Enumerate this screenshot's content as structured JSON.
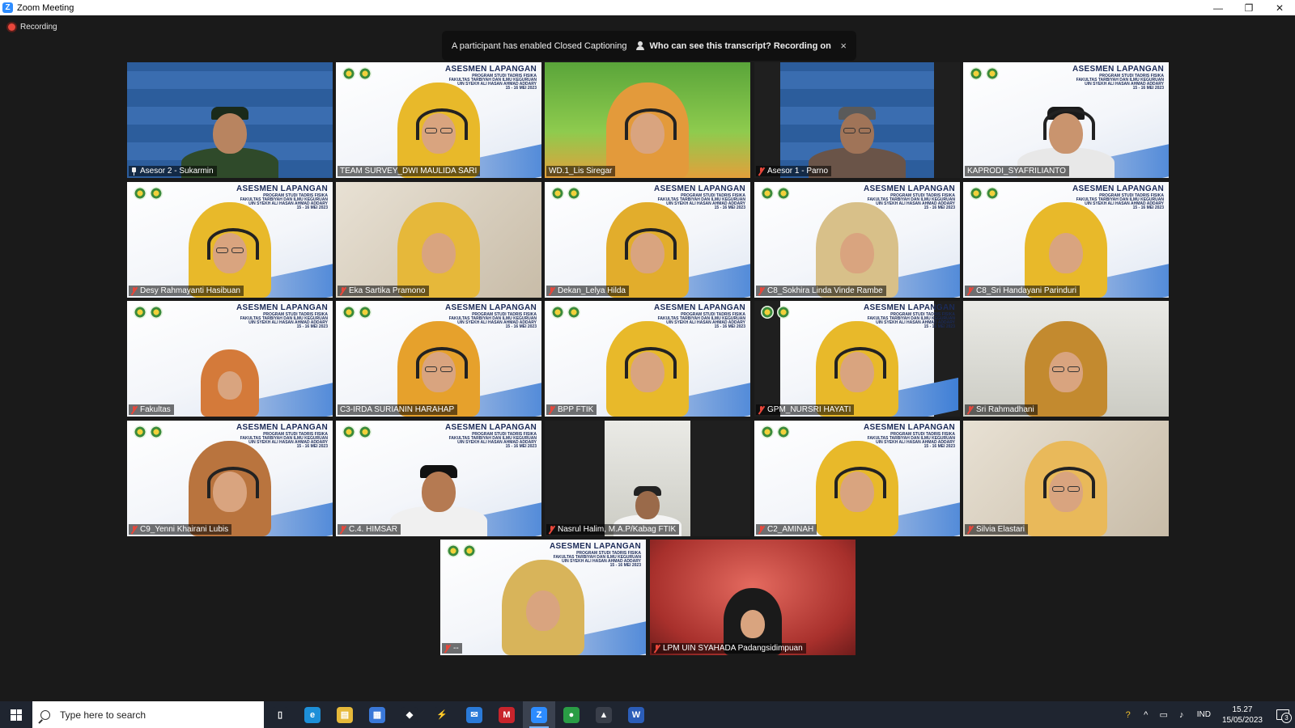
{
  "window": {
    "title": "Zoom Meeting",
    "controls": [
      "minimize",
      "restore",
      "close"
    ]
  },
  "recording": {
    "label": "Recording"
  },
  "caption_banner": {
    "message": "A participant has enabled Closed Captioning",
    "link": "Who can see this transcript? Recording on",
    "close_label": "×"
  },
  "participants": [
    {
      "name": "Asesor 2 - Sukarmin",
      "bg": "blue",
      "icon": "pin",
      "hijab": false,
      "skin": "#b88460",
      "outfit": "#2f4a2a",
      "cap": "#1a2a1a"
    },
    {
      "name": "TEAM SURVEY_DWI MAULIDA SARI",
      "bg": "white",
      "icon": "none",
      "hijab": true,
      "hijab_color": "#e8b92a",
      "headset": true,
      "glasses": true,
      "active": true
    },
    {
      "name": "WD.1_Lis Siregar",
      "bg": "green",
      "icon": "none",
      "hijab": true,
      "hijab_color": "#e39a3b",
      "headset": true
    },
    {
      "name": "Asesor 1 - Parno",
      "bg": "blue",
      "icon": "mic-muted",
      "hijab": false,
      "skin": "#a07458",
      "outfit": "#6a5448",
      "cap": "#5a5a5a",
      "inset": true,
      "glasses": true
    },
    {
      "name": "KAPRODI_SYAFRILIANTO",
      "bg": "white",
      "icon": "none",
      "hijab": false,
      "skin": "#c9946e",
      "outfit": "#e8e8e8",
      "cap": "#1a1a1a",
      "headset": true
    },
    {
      "name": "Desy Rahmayanti Hasibuan",
      "bg": "white",
      "icon": "mic-muted",
      "hijab": true,
      "hijab_color": "#e8b92a",
      "headset": true,
      "glasses": true
    },
    {
      "name": "Eka Sartika Pramono",
      "bg": "room",
      "icon": "mic-muted",
      "hijab": true,
      "hijab_color": "#e6b83a"
    },
    {
      "name": "Dekan_Lelya Hilda",
      "bg": "white",
      "icon": "mic-muted",
      "hijab": true,
      "hijab_color": "#e2ad2c",
      "headset": true
    },
    {
      "name": "C8_Sokhira Linda Vinde Rambe",
      "bg": "white",
      "icon": "mic-muted",
      "hijab": true,
      "hijab_color": "#d8c089"
    },
    {
      "name": "C8_Sri Handayani Parinduri",
      "bg": "white",
      "icon": "mic-muted",
      "hijab": true,
      "hijab_color": "#e8b92a"
    },
    {
      "name": "Fakultas",
      "bg": "white",
      "icon": "mic-muted",
      "hijab": true,
      "hijab_color": "#d47a3a",
      "small": true
    },
    {
      "name": "C3-IRDA SURIANIN HARAHAP",
      "bg": "white",
      "icon": "none",
      "hijab": true,
      "hijab_color": "#e6a12c",
      "headset": true,
      "glasses": true
    },
    {
      "name": "BPP FTIK",
      "bg": "white",
      "icon": "mic-muted",
      "hijab": true,
      "hijab_color": "#e8b92a",
      "headset": true
    },
    {
      "name": "GPM_NURSRI HAYATI",
      "bg": "white",
      "icon": "mic-muted",
      "hijab": true,
      "hijab_color": "#e8b92a",
      "headset": true,
      "inset": true
    },
    {
      "name": "Sri Rahmadhani",
      "bg": "office",
      "icon": "mic-muted",
      "hijab": true,
      "hijab_color": "#c38a2f",
      "glasses": true
    },
    {
      "name": "C9_Yenni Khairani Lubis",
      "bg": "white",
      "icon": "mic-muted",
      "hijab": true,
      "hijab_color": "#b9743e",
      "headset": true
    },
    {
      "name": "C.4. HIMSAR",
      "bg": "white",
      "icon": "mic-muted",
      "hijab": false,
      "skin": "#b57a52",
      "outfit": "#f0f0f0",
      "cap": "#111"
    },
    {
      "name": "Nasrul Halim, M.A.P/Kabag FTIK",
      "bg": "dark",
      "icon": "mic-muted",
      "hijab": false,
      "skin": "#9a6a4a",
      "outfit": "#f4f4f4",
      "cap": "#222",
      "inset": true,
      "small": true
    },
    {
      "name": "C2_AMINAH",
      "bg": "white",
      "icon": "mic-muted",
      "hijab": true,
      "hijab_color": "#e8b92a",
      "headset": true
    },
    {
      "name": "Silvia Elastari",
      "bg": "room",
      "icon": "mic-muted",
      "hijab": true,
      "hijab_color": "#e9b95a",
      "headset": true,
      "glasses": true
    },
    {
      "name": "--",
      "bg": "white",
      "icon": "mic-muted",
      "hijab": true,
      "hijab_color": "#d8b45a"
    },
    {
      "name": "LPM UIN SYAHADA Padangsidimpuan",
      "bg": "red",
      "icon": "mic-muted",
      "hijab": true,
      "hijab_color": "#1a1a1a",
      "small": true
    }
  ],
  "tile_banner": {
    "title": "ASESMEN LAPANGAN",
    "lines": [
      "PROGRAM STUDI TADRIS FISIKA",
      "FAKULTAS TARBIYAH DAN ILMU KEGURUAN",
      "UIN SYEKH ALI HASAN AHMAD ADDARY",
      "15 - 16 MEI 2023"
    ]
  },
  "taskbar": {
    "search_placeholder": "Type here to search",
    "apps": [
      {
        "name": "task-view",
        "glyph": "▯",
        "color": "#1f2530"
      },
      {
        "name": "edge",
        "glyph": "e",
        "color": "#1d8fd8"
      },
      {
        "name": "file-explorer",
        "glyph": "▤",
        "color": "#e6b93a"
      },
      {
        "name": "store",
        "glyph": "▦",
        "color": "#3a78d8"
      },
      {
        "name": "dropbox",
        "glyph": "◆",
        "color": "#1f2530"
      },
      {
        "name": "power-automate",
        "glyph": "⚡",
        "color": "#1f2530"
      },
      {
        "name": "mail",
        "glyph": "✉",
        "color": "#2a7ad8"
      },
      {
        "name": "mendeley",
        "glyph": "M",
        "color": "#c8242c"
      },
      {
        "name": "zoom",
        "glyph": "Z",
        "color": "#2d8cff",
        "focused": true
      },
      {
        "name": "chrome",
        "glyph": "●",
        "color": "#2a9d45"
      },
      {
        "name": "photos",
        "glyph": "▲",
        "color": "#3a3f4a"
      },
      {
        "name": "word",
        "glyph": "W",
        "color": "#2b5db8"
      }
    ],
    "tray": {
      "language": "IND",
      "time": "15.27",
      "date": "15/05/2023",
      "notification_count": "3"
    }
  },
  "colors": {
    "active_speaker": "#f2d02b",
    "muted_icon": "#e8473b",
    "zoom_blue": "#2d8cff"
  }
}
